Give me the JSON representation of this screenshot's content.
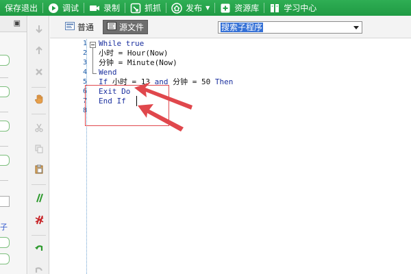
{
  "toolbar": {
    "save_exit": "保存退出",
    "debug": "调试",
    "record": "录制",
    "capture": "抓抓",
    "publish": "发布",
    "resource": "资源库",
    "learning": "学习中心"
  },
  "editor": {
    "mode_normal": "普通",
    "mode_source": "源文件",
    "proc_select_value": "搜索子程序"
  },
  "line_numbers": [
    "1",
    "2",
    "3",
    "4",
    "5",
    "6",
    "7",
    "8"
  ],
  "code": {
    "l1_kw": "While true",
    "l2": "小时 = Hour(Now)",
    "l3": "分钟 = Minute(Now)",
    "l4_kw": "Wend",
    "l5_kw_if": "If",
    "l5_mid1": " 小时 = 13 ",
    "l5_kw_and": "and",
    "l5_mid2": " 分钟 = 50 ",
    "l5_kw_then": "Then",
    "l6_kw": "Exit Do",
    "l7_kw": "End If"
  },
  "left_panel": {
    "link_text": "子"
  },
  "colors": {
    "toolbar_green": "#22a046",
    "keyword_blue": "#1a2f9e",
    "annotation_red": "#e0474c"
  }
}
